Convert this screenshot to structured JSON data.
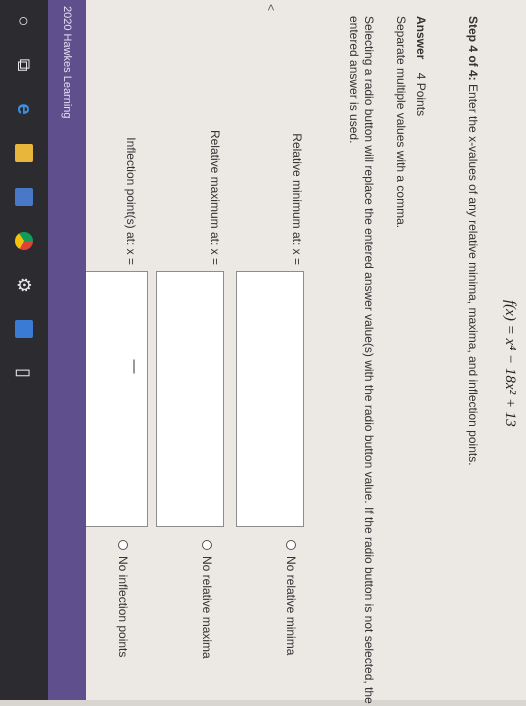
{
  "question": {
    "function": "f(x) = x⁴ − 18x² + 13",
    "step_label": "Step 4 of 4:",
    "step_text": "Enter the x-values of any relative minima, maxima, and inflection points."
  },
  "answer": {
    "heading": "Answer",
    "points": "4 Points",
    "separate_note": "Separate multiple values with a comma.",
    "radio_note": "Selecting a radio button will replace the entered answer value(s) with the radio button value. If the radio button is not selected, the entered answer is used."
  },
  "rows": [
    {
      "label": "Relative minimum at: x =",
      "value": "",
      "radio": "No relative minima"
    },
    {
      "label": "Relative maximum at: x =",
      "value": "",
      "radio": "No relative maxima"
    },
    {
      "label": "Inflection point(s) at: x =",
      "value": "",
      "radio": "No inflection points"
    }
  ],
  "footer": {
    "copyright": "2020 Hawkes Learning"
  },
  "taskbar": {
    "icons": [
      "windows-start-icon",
      "task-view-icon",
      "edge-icon",
      "file-explorer-icon",
      "store-icon",
      "chrome-icon",
      "settings-icon",
      "photos-icon",
      "documents-icon"
    ]
  }
}
